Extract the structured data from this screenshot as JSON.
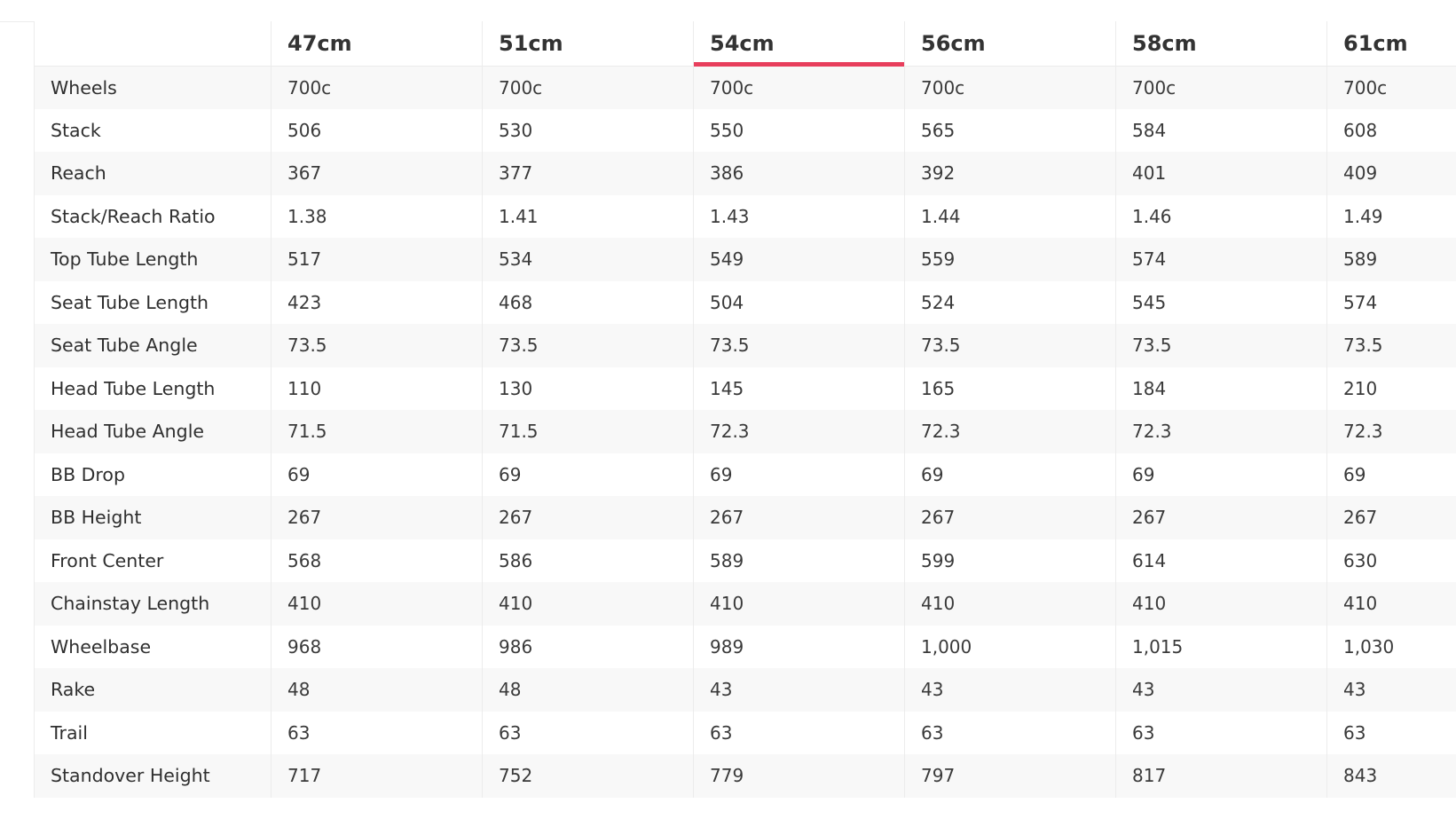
{
  "geometry_table": {
    "sizes": [
      "47cm",
      "51cm",
      "54cm",
      "56cm",
      "58cm",
      "61cm"
    ],
    "selected_size": "54cm",
    "accent_color": "#e83e5c",
    "rows": [
      {
        "label": "Wheels",
        "values": [
          "700c",
          "700c",
          "700c",
          "700c",
          "700c",
          "700c"
        ]
      },
      {
        "label": "Stack",
        "values": [
          "506",
          "530",
          "550",
          "565",
          "584",
          "608"
        ]
      },
      {
        "label": "Reach",
        "values": [
          "367",
          "377",
          "386",
          "392",
          "401",
          "409"
        ]
      },
      {
        "label": "Stack/Reach Ratio",
        "values": [
          "1.38",
          "1.41",
          "1.43",
          "1.44",
          "1.46",
          "1.49"
        ]
      },
      {
        "label": "Top Tube Length",
        "values": [
          "517",
          "534",
          "549",
          "559",
          "574",
          "589"
        ]
      },
      {
        "label": "Seat Tube Length",
        "values": [
          "423",
          "468",
          "504",
          "524",
          "545",
          "574"
        ]
      },
      {
        "label": "Seat Tube Angle",
        "values": [
          "73.5",
          "73.5",
          "73.5",
          "73.5",
          "73.5",
          "73.5"
        ]
      },
      {
        "label": "Head Tube Length",
        "values": [
          "110",
          "130",
          "145",
          "165",
          "184",
          "210"
        ]
      },
      {
        "label": "Head Tube Angle",
        "values": [
          "71.5",
          "71.5",
          "72.3",
          "72.3",
          "72.3",
          "72.3"
        ]
      },
      {
        "label": "BB Drop",
        "values": [
          "69",
          "69",
          "69",
          "69",
          "69",
          "69"
        ]
      },
      {
        "label": "BB Height",
        "values": [
          "267",
          "267",
          "267",
          "267",
          "267",
          "267"
        ]
      },
      {
        "label": "Front Center",
        "values": [
          "568",
          "586",
          "589",
          "599",
          "614",
          "630"
        ]
      },
      {
        "label": "Chainstay Length",
        "values": [
          "410",
          "410",
          "410",
          "410",
          "410",
          "410"
        ]
      },
      {
        "label": "Wheelbase",
        "values": [
          "968",
          "986",
          "989",
          "1,000",
          "1,015",
          "1,030"
        ]
      },
      {
        "label": "Rake",
        "values": [
          "48",
          "48",
          "43",
          "43",
          "43",
          "43"
        ]
      },
      {
        "label": "Trail",
        "values": [
          "63",
          "63",
          "63",
          "63",
          "63",
          "63"
        ]
      },
      {
        "label": "Standover Height",
        "values": [
          "717",
          "752",
          "779",
          "797",
          "817",
          "843"
        ]
      }
    ]
  }
}
